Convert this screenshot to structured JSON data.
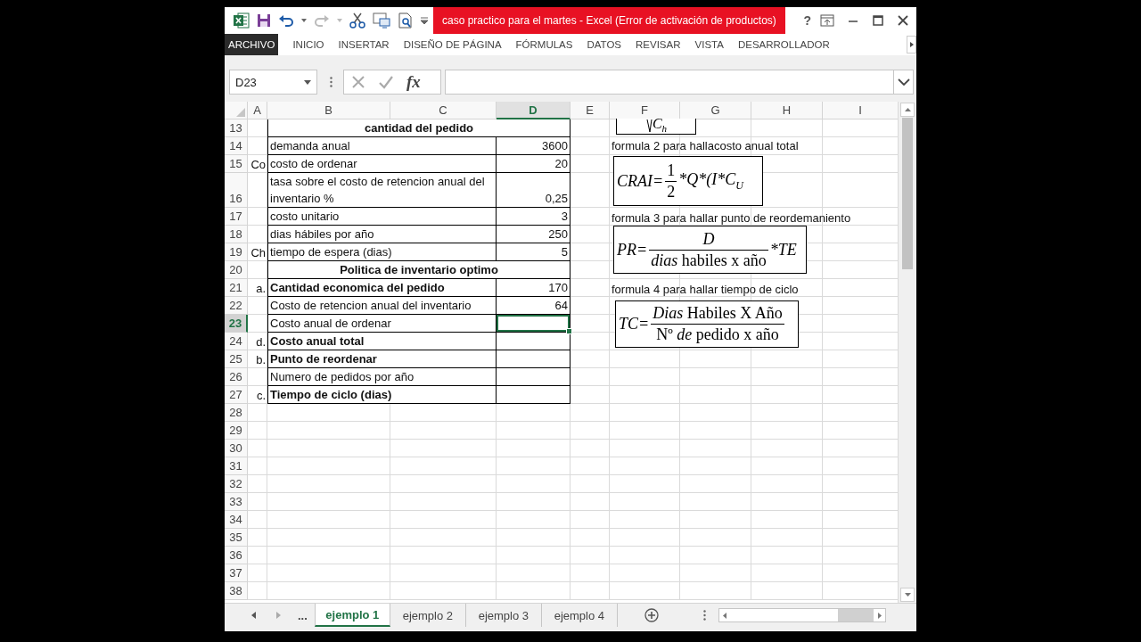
{
  "window": {
    "title": "caso practico para el martes -  Excel (Error de activación de productos)",
    "help_button": "?"
  },
  "ribbon_tabs": [
    {
      "label": "ARCHIVO",
      "selected": true
    },
    {
      "label": "INICIO",
      "selected": false
    },
    {
      "label": "INSERTAR",
      "selected": false
    },
    {
      "label": "DISEÑO DE PÁGINA",
      "selected": false
    },
    {
      "label": "FÓRMULAS",
      "selected": false
    },
    {
      "label": "DATOS",
      "selected": false
    },
    {
      "label": "REVISAR",
      "selected": false
    },
    {
      "label": "VISTA",
      "selected": false
    },
    {
      "label": "DESARROLLADOR",
      "selected": false
    }
  ],
  "formula_bar": {
    "name_box": "D23",
    "function_button": "fx"
  },
  "columns": [
    {
      "label": "A",
      "selected": false
    },
    {
      "label": "B",
      "selected": false
    },
    {
      "label": "C",
      "selected": false
    },
    {
      "label": "D",
      "selected": true
    },
    {
      "label": "E",
      "selected": false
    },
    {
      "label": "F",
      "selected": false
    },
    {
      "label": "G",
      "selected": false
    },
    {
      "label": "H",
      "selected": false
    },
    {
      "label": "I",
      "selected": false
    }
  ],
  "rows": [
    {
      "number": "13",
      "kind": "title",
      "selected": false,
      "b": "cantidad del pedido"
    },
    {
      "number": "14",
      "kind": "item",
      "selected": false,
      "bold": false,
      "b": "demanda anual",
      "d": "3600"
    },
    {
      "number": "15",
      "kind": "item",
      "selected": false,
      "bold": false,
      "a": "Co",
      "b": "costo de ordenar",
      "d": "20"
    },
    {
      "number": "16",
      "kind": "item",
      "selected": false,
      "bold": false,
      "b": "tasa sobre el costo de retencion anual del inventario %",
      "d": "0,25"
    },
    {
      "number": "17",
      "kind": "item",
      "selected": false,
      "bold": false,
      "b": "costo unitario",
      "d": "3"
    },
    {
      "number": "18",
      "kind": "item",
      "selected": false,
      "bold": false,
      "b": "dias hábiles por año",
      "d": "250"
    },
    {
      "number": "19",
      "kind": "item",
      "selected": false,
      "bold": false,
      "a": "Ch",
      "b": "tiempo de espera (dias)",
      "d": "5"
    },
    {
      "number": "20",
      "kind": "title",
      "selected": false,
      "b": "Politica de inventario optimo"
    },
    {
      "number": "21",
      "kind": "item",
      "selected": false,
      "bold": true,
      "a": "a.",
      "b": "Cantidad economica del pedido",
      "d": "170"
    },
    {
      "number": "22",
      "kind": "item",
      "selected": false,
      "bold": false,
      "b": "Costo de retencion anual del inventario",
      "d": "64"
    },
    {
      "number": "23",
      "kind": "item",
      "selected": true,
      "bold": false,
      "b": "Costo anual de ordenar"
    },
    {
      "number": "24",
      "kind": "item",
      "selected": false,
      "bold": true,
      "a": "d.",
      "b": "Costo anual total"
    },
    {
      "number": "25",
      "kind": "item",
      "selected": false,
      "bold": true,
      "a": "b.",
      "b": "Punto de reordenar"
    },
    {
      "number": "26",
      "kind": "item",
      "selected": false,
      "bold": false,
      "b": "Numero de pedidos por año"
    },
    {
      "number": "27",
      "kind": "item",
      "selected": false,
      "bold": true,
      "a": "c.",
      "b": "Tiempo de ciclo (dias)"
    },
    {
      "number": "28",
      "kind": "empty",
      "selected": false
    },
    {
      "number": "29",
      "kind": "empty",
      "selected": false
    },
    {
      "number": "30",
      "kind": "empty",
      "selected": false
    },
    {
      "number": "31",
      "kind": "empty",
      "selected": false
    },
    {
      "number": "32",
      "kind": "empty",
      "selected": false
    },
    {
      "number": "33",
      "kind": "empty",
      "selected": false
    },
    {
      "number": "34",
      "kind": "empty",
      "selected": false
    },
    {
      "number": "35",
      "kind": "empty",
      "selected": false
    },
    {
      "number": "36",
      "kind": "empty",
      "selected": false
    },
    {
      "number": "37",
      "kind": "empty",
      "selected": false
    },
    {
      "number": "38",
      "kind": "empty",
      "selected": false
    }
  ],
  "equations": [
    {
      "kind": "fragment",
      "base": "C",
      "subscript": "h"
    },
    {
      "kind": "fraction",
      "label": "formula 2 para hallacosto anual total",
      "lhs": "CRAI=",
      "numerator": "1",
      "denominator": "2",
      "rest": "*Q*(I*C",
      "rest_subscript": "U"
    },
    {
      "kind": "fraction",
      "label": "formula 3 para hallar punto de reordemaniento",
      "lhs": "PR=",
      "numerator": "*D*",
      "denominator": "*dias* habiles  x  año",
      "rest": "*TE"
    },
    {
      "kind": "fraction",
      "label": "formula 4 para hallar tiempo de ciclo",
      "lhs": "TC=",
      "numerator": "*Dias*  Habiles  X  Año",
      "denominator": "Nº *de*  pedido x  año"
    }
  ],
  "sheet_tabs": {
    "more": "...",
    "tabs": [
      {
        "label": "ejemplo 1",
        "selected": true
      },
      {
        "label": "ejemplo 2",
        "selected": false
      },
      {
        "label": "ejemplo 3",
        "selected": false
      },
      {
        "label": "ejemplo 4",
        "selected": false
      }
    ]
  }
}
